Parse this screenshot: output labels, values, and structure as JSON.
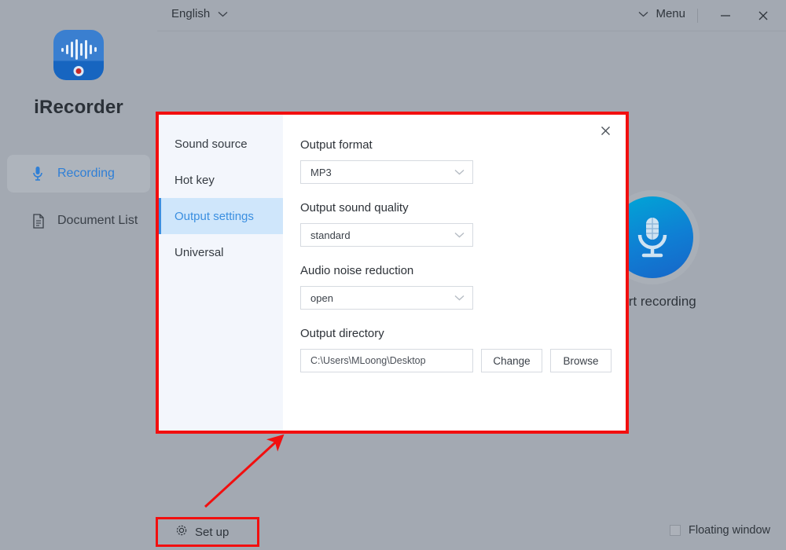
{
  "app": {
    "name": "iRecorder",
    "logo_icon": "waveform-record-icon",
    "background_color": "#a3a9b2",
    "accent_color": "#3b8fe0",
    "annotation_color": "#f20f0f"
  },
  "header": {
    "language": "English",
    "language_chevron_icon": "chevron-down-icon",
    "menu_label": "Menu",
    "menu_chevron_icon": "chevron-down-icon",
    "minimize_icon": "minimize-icon",
    "minimize_glyph": "—",
    "close_icon": "close-icon",
    "close_glyph": "✕"
  },
  "sidebar": {
    "items": [
      {
        "label": "Recording",
        "icon": "microphone-icon",
        "active": true
      },
      {
        "label": "Document List",
        "icon": "document-icon",
        "active": false
      }
    ]
  },
  "main": {
    "record_button_icon": "microphone-icon",
    "record_label": "Start recording"
  },
  "dialog": {
    "close_icon": "close-icon",
    "close_glyph": "✕",
    "nav": [
      {
        "label": "Sound source",
        "active": false
      },
      {
        "label": "Hot key",
        "active": false
      },
      {
        "label": "Output settings",
        "active": true
      },
      {
        "label": "Universal",
        "active": false
      }
    ],
    "fields": [
      {
        "label": "Output format",
        "value": "MP3",
        "chevron_icon": "chevron-down-icon"
      },
      {
        "label": "Output sound quality",
        "value": "standard",
        "chevron_icon": "chevron-down-icon"
      },
      {
        "label": "Audio noise reduction",
        "value": "open",
        "chevron_icon": "chevron-down-icon"
      }
    ],
    "directory": {
      "label": "Output directory",
      "path": "C:\\Users\\MLoong\\Desktop",
      "change_label": "Change",
      "browse_label": "Browse"
    }
  },
  "footer": {
    "setup_label": "Set up",
    "setup_icon": "gear-icon",
    "floating_window_label": "Floating window",
    "floating_window_checked": false
  }
}
